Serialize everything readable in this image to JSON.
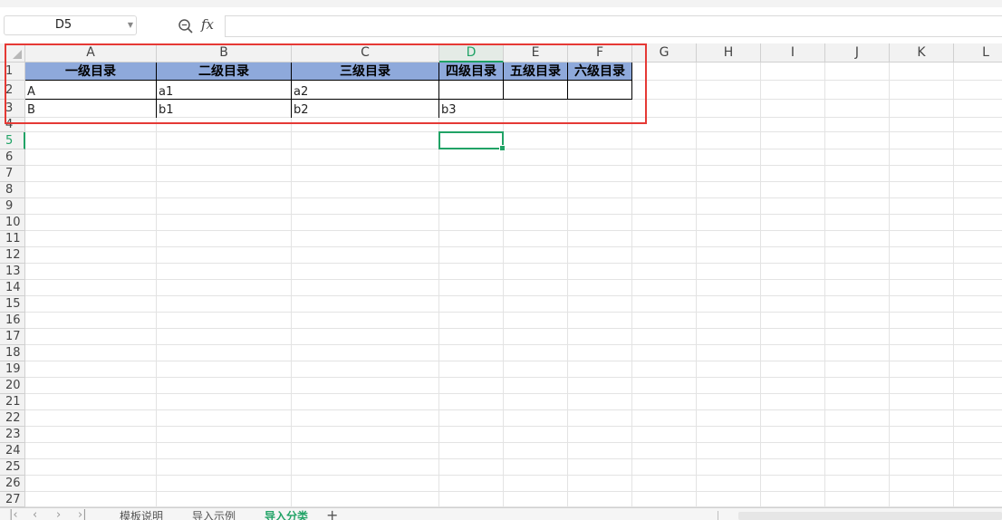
{
  "formula_bar": {
    "name_box": "D5",
    "fx_label": "fx",
    "formula": ""
  },
  "columns": [
    "A",
    "B",
    "C",
    "D",
    "E",
    "F",
    "G",
    "H",
    "I",
    "J",
    "K",
    "L"
  ],
  "rows": [
    "1",
    "2",
    "3",
    "4",
    "5",
    "6",
    "7",
    "8",
    "9",
    "10",
    "11",
    "12",
    "13",
    "14",
    "15",
    "16",
    "17",
    "18",
    "19",
    "20",
    "21",
    "22",
    "23",
    "24",
    "25",
    "26",
    "27"
  ],
  "selected": {
    "cell": "D5",
    "column": "D",
    "row": "5"
  },
  "table": {
    "headers": [
      "一级目录",
      "二级目录",
      "三级目录",
      "四级目录",
      "五级目录",
      "六级目录"
    ],
    "rows": [
      [
        "A",
        "a1",
        "a2",
        "",
        "",
        ""
      ],
      [
        "B",
        "b1",
        "b2",
        "b3",
        "",
        ""
      ]
    ]
  },
  "sheet_tabs": [
    "模板说明",
    "导入示例",
    "导入分类"
  ],
  "active_sheet": "导入分类",
  "colors": {
    "header_fill": "#8ea9db",
    "selection": "#21a366",
    "highlight_box": "#e53935"
  }
}
